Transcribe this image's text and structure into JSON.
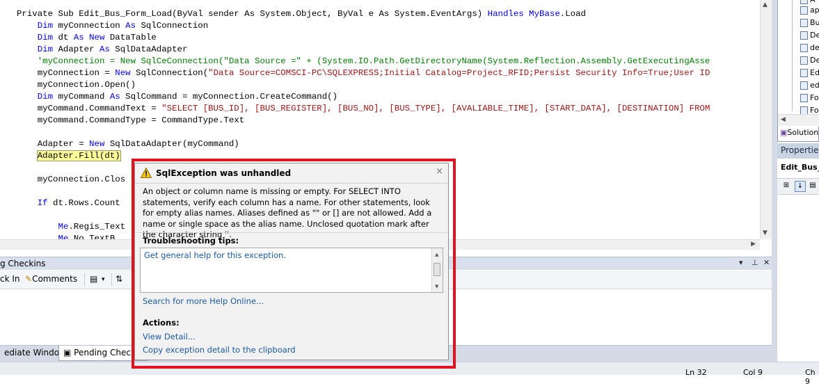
{
  "code": {
    "lines": [
      [
        {
          "t": "Private Sub Edit_Bus_Form_Load(ByVal sender As System.Object, ByVal e As System.EventArgs) "
        },
        {
          "t": "Handles",
          "c": "kw"
        },
        {
          "t": " "
        },
        {
          "t": "MyBase",
          "c": "kw"
        },
        {
          "t": ".Load"
        }
      ],
      [
        {
          "t": "    "
        },
        {
          "t": "Dim",
          "c": "kw"
        },
        {
          "t": " myConnection "
        },
        {
          "t": "As",
          "c": "kw"
        },
        {
          "t": " SqlConnection"
        }
      ],
      [
        {
          "t": "    "
        },
        {
          "t": "Dim",
          "c": "kw"
        },
        {
          "t": " dt "
        },
        {
          "t": "As",
          "c": "kw"
        },
        {
          "t": " "
        },
        {
          "t": "New",
          "c": "kw"
        },
        {
          "t": " DataTable"
        }
      ],
      [
        {
          "t": "    "
        },
        {
          "t": "Dim",
          "c": "kw"
        },
        {
          "t": " Adapter "
        },
        {
          "t": "As",
          "c": "kw"
        },
        {
          "t": " SqlDataAdapter"
        }
      ],
      [
        {
          "t": "    'myConnection = New SqlCeConnection(\"Data Source =\" + (System.IO.Path.GetDirectoryName(System.Reflection.Assembly.GetExecutingAsse",
          "c": "cm"
        }
      ],
      [
        {
          "t": "    myConnection = "
        },
        {
          "t": "New",
          "c": "kw"
        },
        {
          "t": " SqlConnection("
        },
        {
          "t": "\"Data Source=COMSCI-PC\\SQLEXPRESS;Initial Catalog=Project_RFID;Persist Security Info=True;User ID",
          "c": "str"
        }
      ],
      [
        {
          "t": "    myConnection.Open()"
        }
      ],
      [
        {
          "t": "    "
        },
        {
          "t": "Dim",
          "c": "kw"
        },
        {
          "t": " myCommand "
        },
        {
          "t": "As",
          "c": "kw"
        },
        {
          "t": " SqlCommand = myConnection.CreateCommand()"
        }
      ],
      [
        {
          "t": "    myCommand.CommandText = "
        },
        {
          "t": "\"SELECT [BUS_ID], [BUS_REGISTER], [BUS_NO], [BUS_TYPE], [AVALIABLE_TIME], [START_DATA], [DESTINATION] FROM",
          "c": "str"
        }
      ],
      [
        {
          "t": "    myCommand.CommandType = CommandType.Text"
        }
      ],
      [
        {
          "t": ""
        }
      ],
      [
        {
          "t": "    Adapter = "
        },
        {
          "t": "New",
          "c": "kw"
        },
        {
          "t": " SqlDataAdapter(myCommand)"
        }
      ],
      [
        {
          "t": "    "
        },
        {
          "t": "Adapter.Fill(dt)",
          "c": "hl"
        }
      ],
      [
        {
          "t": ""
        }
      ],
      [
        {
          "t": "    myConnection.Clos"
        }
      ],
      [
        {
          "t": ""
        }
      ],
      [
        {
          "t": "    "
        },
        {
          "t": "If",
          "c": "kw"
        },
        {
          "t": " dt.Rows.Count"
        }
      ],
      [
        {
          "t": ""
        }
      ],
      [
        {
          "t": "        "
        },
        {
          "t": "Me",
          "c": "kw"
        },
        {
          "t": ".Regis_Text"
        }
      ],
      [
        {
          "t": "        "
        },
        {
          "t": "Me",
          "c": "kw"
        },
        {
          "t": ".No_TextB"
        }
      ]
    ]
  },
  "exception": {
    "title": "SqlException was unhandled",
    "message": "An object or column name is missing or empty. For SELECT INTO statements, verify each column has a name. For other statements, look for empty alias names. Aliases defined as \"\" or [] are not allowed. Add a name or single space as the alias name.  Unclosed quotation mark after the character string ''.",
    "tips_heading": "Troubleshooting tips:",
    "tips": [
      "Get general help for this exception."
    ],
    "search_link": "Search for more Help Online...",
    "actions_heading": "Actions:",
    "actions": [
      "View Detail...",
      "Copy exception detail to the clipboard"
    ],
    "close_glyph": "×"
  },
  "pending": {
    "title": "g Checkins",
    "toolbar": {
      "checkin": "ck In",
      "comments": "Comments"
    },
    "controls": {
      "dropdown": "▾",
      "pin": "⊥",
      "close": "✕"
    }
  },
  "tabs": [
    {
      "label": "ediate Window"
    },
    {
      "label": "Pending Checkin"
    }
  ],
  "status": {
    "ln": "Ln 32",
    "col": "Col 9",
    "ch": "Ch 9"
  },
  "solution": {
    "items": [
      "ap",
      "Bu",
      "De",
      "de",
      "De",
      "Ed",
      "ed",
      "Fo",
      "Fo"
    ],
    "first_item": "A",
    "tab": "Solution"
  },
  "properties": {
    "title": "Properties",
    "object": "Edit_Bus_F"
  }
}
